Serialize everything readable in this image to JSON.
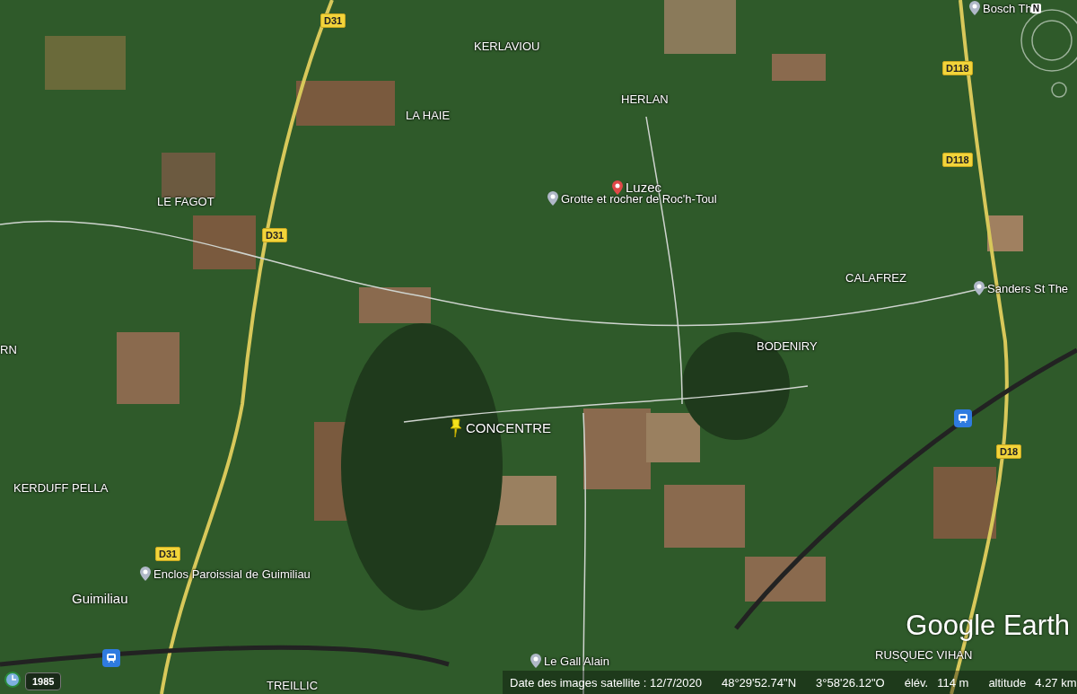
{
  "map": {
    "labels": [
      {
        "kind": "poi",
        "text": "Bosch Th"
      },
      {
        "kind": "road",
        "text": "D31"
      },
      {
        "kind": "place",
        "text": "KERLAVIOU"
      },
      {
        "kind": "road",
        "text": "D118"
      },
      {
        "kind": "place",
        "text": "HERLAN"
      },
      {
        "kind": "place",
        "text": "LA HAIE"
      },
      {
        "kind": "road",
        "text": "D118"
      },
      {
        "kind": "town",
        "text": "Luzec"
      },
      {
        "kind": "place",
        "text": "LE FAGOT"
      },
      {
        "kind": "poi",
        "text": "Grotte et rocher de Roc'h-Toul"
      },
      {
        "kind": "road",
        "text": "D31"
      },
      {
        "kind": "place",
        "text": "CALAFREZ"
      },
      {
        "kind": "poi",
        "text": "Sanders St The"
      },
      {
        "kind": "place",
        "text": "BODENIRY"
      },
      {
        "kind": "place",
        "text": "RN"
      },
      {
        "kind": "station"
      },
      {
        "kind": "pushpin",
        "text": "CONCENTRE"
      },
      {
        "kind": "road",
        "text": "D18"
      },
      {
        "kind": "place",
        "text": "KERDUFF PELLA"
      },
      {
        "kind": "road",
        "text": "D31"
      },
      {
        "kind": "poi",
        "text": "Enclos Paroissial de Guimiliau"
      },
      {
        "kind": "town_plain",
        "text": "Guimiliau"
      },
      {
        "kind": "place",
        "text": "RUSQUEC VIHAN"
      },
      {
        "kind": "station"
      },
      {
        "kind": "place",
        "text": "TREILLIC"
      },
      {
        "kind": "poi",
        "text": "Le Gall Alain"
      }
    ]
  },
  "compass": {
    "north": "N"
  },
  "logo": "Google Earth",
  "time_slider": {
    "year": "1985"
  },
  "status_bar": {
    "imagery_date": "Date des images satellite : 12/7/2020",
    "latitude": "48°29'52.74\"N",
    "longitude": "3°58'26.12\"O",
    "elevation_label": "élév.",
    "elevation": "114 m",
    "altitude_label": "altitude",
    "altitude": "4.27 km"
  }
}
